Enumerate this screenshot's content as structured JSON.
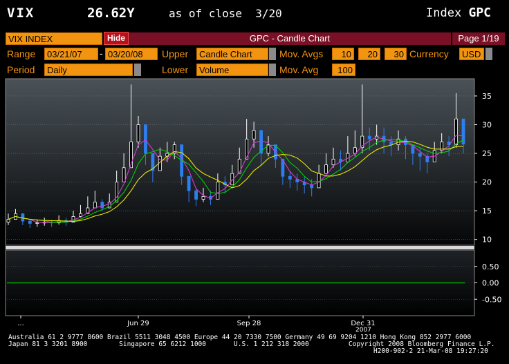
{
  "header": {
    "ticker": "VIX",
    "price": "26.62Y",
    "as_of": "as of close",
    "date": "3/20",
    "index_label": "Index",
    "index_code": "GPC"
  },
  "toolbar": {
    "security": "VIX INDEX",
    "hide_label": "Hide",
    "chart_title": "GPC - Candle Chart",
    "page": "Page 1/19",
    "range_label": "Range",
    "range_start": "03/21/07",
    "range_sep": "-",
    "range_end": "03/20/08",
    "upper_label": "Upper",
    "upper_value": "Candle Chart",
    "movavgs_label": "Mov. Avgs",
    "movavgs": [
      "10",
      "20",
      "30"
    ],
    "currency_label": "Currency",
    "currency_value": "USD",
    "period_label": "Period",
    "period_value": "Daily",
    "lower_label": "Lower",
    "lower_value": "Volume",
    "movavg_label": "Mov. Avg",
    "movavg_value": "100"
  },
  "chart_data": [
    {
      "type": "candlestick",
      "ylim": [
        9,
        38
      ],
      "yticks": [
        "10",
        "15",
        "20",
        "25",
        "30",
        "35"
      ],
      "xticks": [
        "...",
        "Jun 29",
        "Sep 28",
        "Dec 31"
      ],
      "year_label": "2007",
      "x": [
        0,
        4,
        8,
        12,
        16,
        20,
        24,
        28,
        32,
        36,
        40,
        44,
        48,
        52,
        56,
        60,
        64,
        68,
        72,
        76,
        80,
        84,
        88,
        92,
        96,
        100,
        104,
        108,
        112,
        116,
        120,
        124,
        128,
        132,
        136,
        140,
        144,
        148,
        152,
        156,
        160,
        164,
        168,
        172,
        176,
        180,
        184,
        188,
        192,
        196,
        200,
        204,
        208,
        212,
        216,
        220,
        224,
        228,
        232,
        236,
        240,
        244,
        248,
        252
      ],
      "close": [
        13.5,
        14.5,
        13.2,
        12.8,
        12.9,
        13.0,
        12.9,
        13.3,
        13.0,
        14.0,
        14.5,
        15.5,
        16.5,
        15.5,
        16.5,
        20.0,
        22.5,
        27.0,
        30.0,
        25.0,
        22.0,
        24.5,
        25.0,
        26.5,
        21.0,
        18.5,
        17.0,
        17.5,
        17.0,
        20.0,
        19.5,
        21.5,
        24.0,
        27.5,
        29.0,
        25.0,
        26.5,
        24.0,
        21.0,
        20.5,
        20.0,
        19.5,
        19.0,
        21.5,
        23.0,
        24.0,
        23.5,
        25.0,
        26.0,
        28.0,
        27.5,
        28.0,
        27.0,
        26.5,
        27.5,
        26.5,
        25.0,
        24.5,
        23.5,
        25.5,
        27.0,
        26.5,
        31.0,
        26.62
      ],
      "high": [
        14.5,
        15.3,
        14.0,
        13.6,
        13.5,
        13.8,
        13.4,
        14.2,
        13.8,
        15.0,
        16.0,
        17.5,
        18.5,
        17.0,
        18.0,
        22.0,
        25.0,
        37.0,
        31.5,
        27.0,
        25.0,
        26.0,
        27.0,
        27.0,
        23.0,
        20.0,
        19.0,
        19.0,
        18.5,
        21.5,
        21.0,
        23.0,
        26.0,
        31.0,
        30.5,
        27.5,
        28.0,
        26.0,
        23.0,
        22.0,
        21.5,
        21.0,
        20.5,
        23.0,
        25.0,
        26.0,
        25.5,
        28.0,
        29.0,
        37.0,
        29.5,
        30.0,
        29.5,
        28.0,
        29.0,
        28.0,
        26.5,
        26.0,
        25.0,
        27.0,
        28.5,
        28.0,
        35.5,
        29.0
      ],
      "low": [
        12.5,
        13.5,
        12.5,
        12.0,
        12.2,
        12.4,
        12.2,
        12.6,
        12.4,
        13.2,
        13.8,
        14.8,
        15.5,
        15.0,
        15.8,
        18.5,
        20.0,
        24.0,
        26.0,
        23.0,
        20.0,
        22.0,
        23.5,
        24.0,
        19.5,
        16.5,
        15.8,
        16.5,
        16.0,
        18.5,
        18.0,
        20.0,
        22.0,
        25.0,
        26.0,
        23.0,
        24.5,
        22.5,
        19.5,
        19.0,
        18.5,
        18.0,
        17.5,
        20.0,
        21.5,
        22.5,
        22.0,
        23.5,
        24.5,
        25.0,
        25.5,
        26.5,
        25.0,
        24.5,
        25.5,
        24.0,
        23.0,
        22.0,
        21.5,
        23.5,
        25.0,
        24.5,
        26.0,
        25.0
      ]
    },
    {
      "type": "line",
      "ylim": [
        -1.0,
        1.0
      ],
      "yticks": [
        "0.50",
        "0.00",
        "-0.50"
      ],
      "values": [
        0,
        0
      ]
    }
  ],
  "footer": {
    "line1": "Australia 61 2 9777 8600 Brazil 5511 3048 4500 Europe 44 20 7330 7500 Germany 49 69 9204 1210 Hong Kong 852 2977 6000",
    "line2": "Japan 81 3 3201 8900        Singapore 65 6212 1000       U.S. 1 212 318 2000          Copyright 2008 Bloomberg Finance L.P.",
    "line3": "H200-902-2 21-Mar-08 19:27:20"
  },
  "colors": {
    "orange": "#f29410",
    "red_bar": "#7a1026",
    "ma10": "#d23cd2",
    "ma20": "#00d000",
    "ma30": "#e8e800",
    "candle_up": "#ffffff",
    "candle_down": "#2d7ef0",
    "zero_line": "#00b000"
  }
}
